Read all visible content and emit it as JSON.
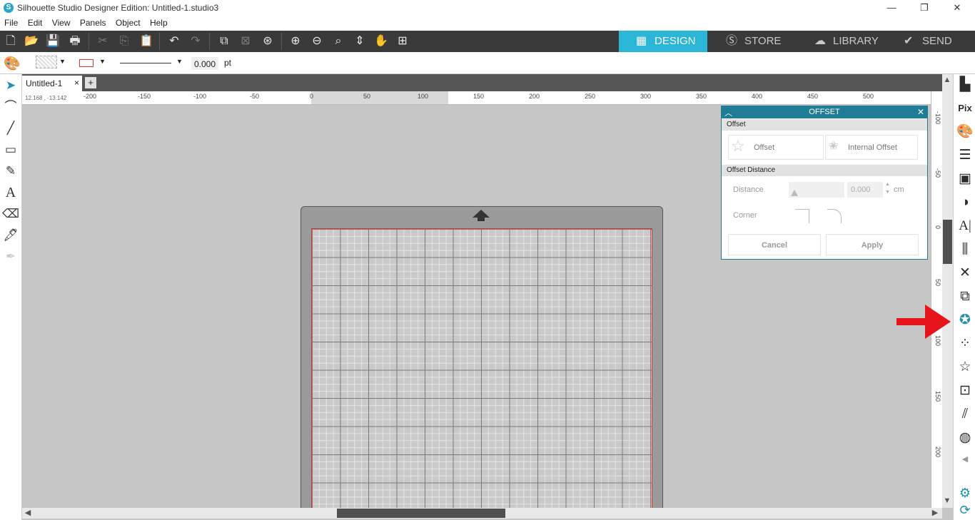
{
  "window": {
    "title": "Silhouette Studio Designer Edition: Untitled-1.studio3",
    "minimize": "—",
    "restore": "❐",
    "close": "✕"
  },
  "menu": [
    "File",
    "Edit",
    "View",
    "Panels",
    "Object",
    "Help"
  ],
  "nav_tabs": [
    {
      "label": "DESIGN",
      "icon": "grid-icon",
      "active": true
    },
    {
      "label": "STORE",
      "icon": "silhouette-s-icon",
      "active": false
    },
    {
      "label": "LIBRARY",
      "icon": "cloud-icon",
      "active": false
    },
    {
      "label": "SEND",
      "icon": "check-circle-icon",
      "active": false
    }
  ],
  "properties": {
    "line_weight_value": "0.000",
    "line_weight_unit": "pt"
  },
  "document_tab": {
    "name": "Untitled-1",
    "close": "×",
    "add": "+"
  },
  "ruler": {
    "coordinates": "12.168 , -13.142",
    "labels": [
      "-200",
      "-150",
      "-100",
      "-50",
      "0",
      "50",
      "100",
      "150",
      "200",
      "250",
      "300",
      "350",
      "400",
      "450",
      "500"
    ],
    "vertical_labels": [
      "-100",
      "-50",
      "0",
      "50",
      "100",
      "150",
      "200"
    ]
  },
  "offset_panel": {
    "title": "OFFSET",
    "section_offset": "Offset",
    "option_offset": "Offset",
    "option_internal": "Internal Offset",
    "section_distance": "Offset Distance",
    "distance_label": "Distance",
    "distance_value": "0.000",
    "distance_unit": "cm",
    "corner_label": "Corner",
    "cancel": "Cancel",
    "apply": "Apply"
  },
  "colors": {
    "accent": "#2bb5d7",
    "panel_header": "#1f7d95",
    "toolbar_bg": "#3a3a3a",
    "annotation_arrow": "#e8141b"
  }
}
